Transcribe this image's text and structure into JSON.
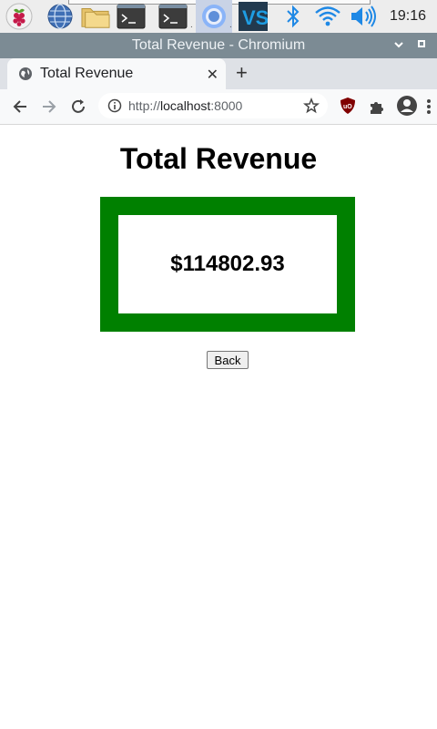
{
  "taskbar": {
    "icons": [
      "raspberry-menu-icon",
      "globe-icon",
      "folder-icon",
      "terminal-icon",
      "terminal-icon",
      "chromium-icon",
      "vscode-icon",
      "bluetooth-icon",
      "wifi-icon",
      "volume-icon"
    ],
    "clock": "19:16"
  },
  "window": {
    "title": "Total Revenue - Chromium"
  },
  "browser": {
    "tab_title": "Total Revenue",
    "close_glyph": "✕",
    "new_tab_glyph": "+",
    "url_scheme": "http://",
    "url_host": "localhost",
    "url_port": ":8000"
  },
  "page": {
    "title": "Total Revenue",
    "revenue": "$114802.93",
    "back_label": "Back",
    "card_color": "#008000"
  }
}
